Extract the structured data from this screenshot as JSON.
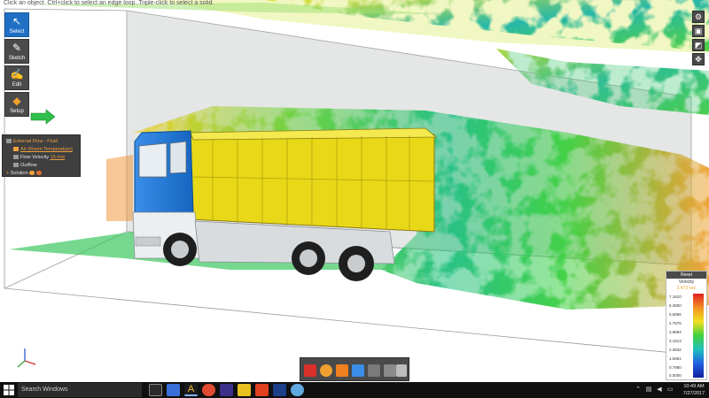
{
  "status_hint": "Click an object. Ctrl+click to select an edge loop. Triple-click to select a solid.",
  "left_toolbar": {
    "items": [
      {
        "id": "select",
        "label": "Select",
        "active": true
      },
      {
        "id": "sketch",
        "label": "Sketch",
        "active": false
      },
      {
        "id": "edit",
        "label": "Edit",
        "active": false
      },
      {
        "id": "setup",
        "label": "Setup",
        "active": false
      }
    ]
  },
  "browser": {
    "root": "External Flow - Fluid",
    "material": "Air (Room Temperature)",
    "inlet_label": "Flow Velocity",
    "inlet_value": "15 m/s",
    "outflow": "Outflow",
    "solution": "Solution"
  },
  "legend": {
    "reset_label": "Reset",
    "quantity": "Velocity",
    "time": "2.473 sec",
    "ticks": [
      "7.1810",
      "6.3800",
      "5.5856",
      "4.7875",
      "3.9894",
      "3.1913",
      "2.3932",
      "1.5951",
      "0.7980",
      "0.0000"
    ]
  },
  "taskbar": {
    "search_placeholder": "Search Windows",
    "time": "10:49 AM",
    "date": "7/27/2017"
  },
  "colors": {
    "accent": "#1f6fc4",
    "truck_cab": "#1f78d1",
    "truck_bed": "#f0e020"
  }
}
